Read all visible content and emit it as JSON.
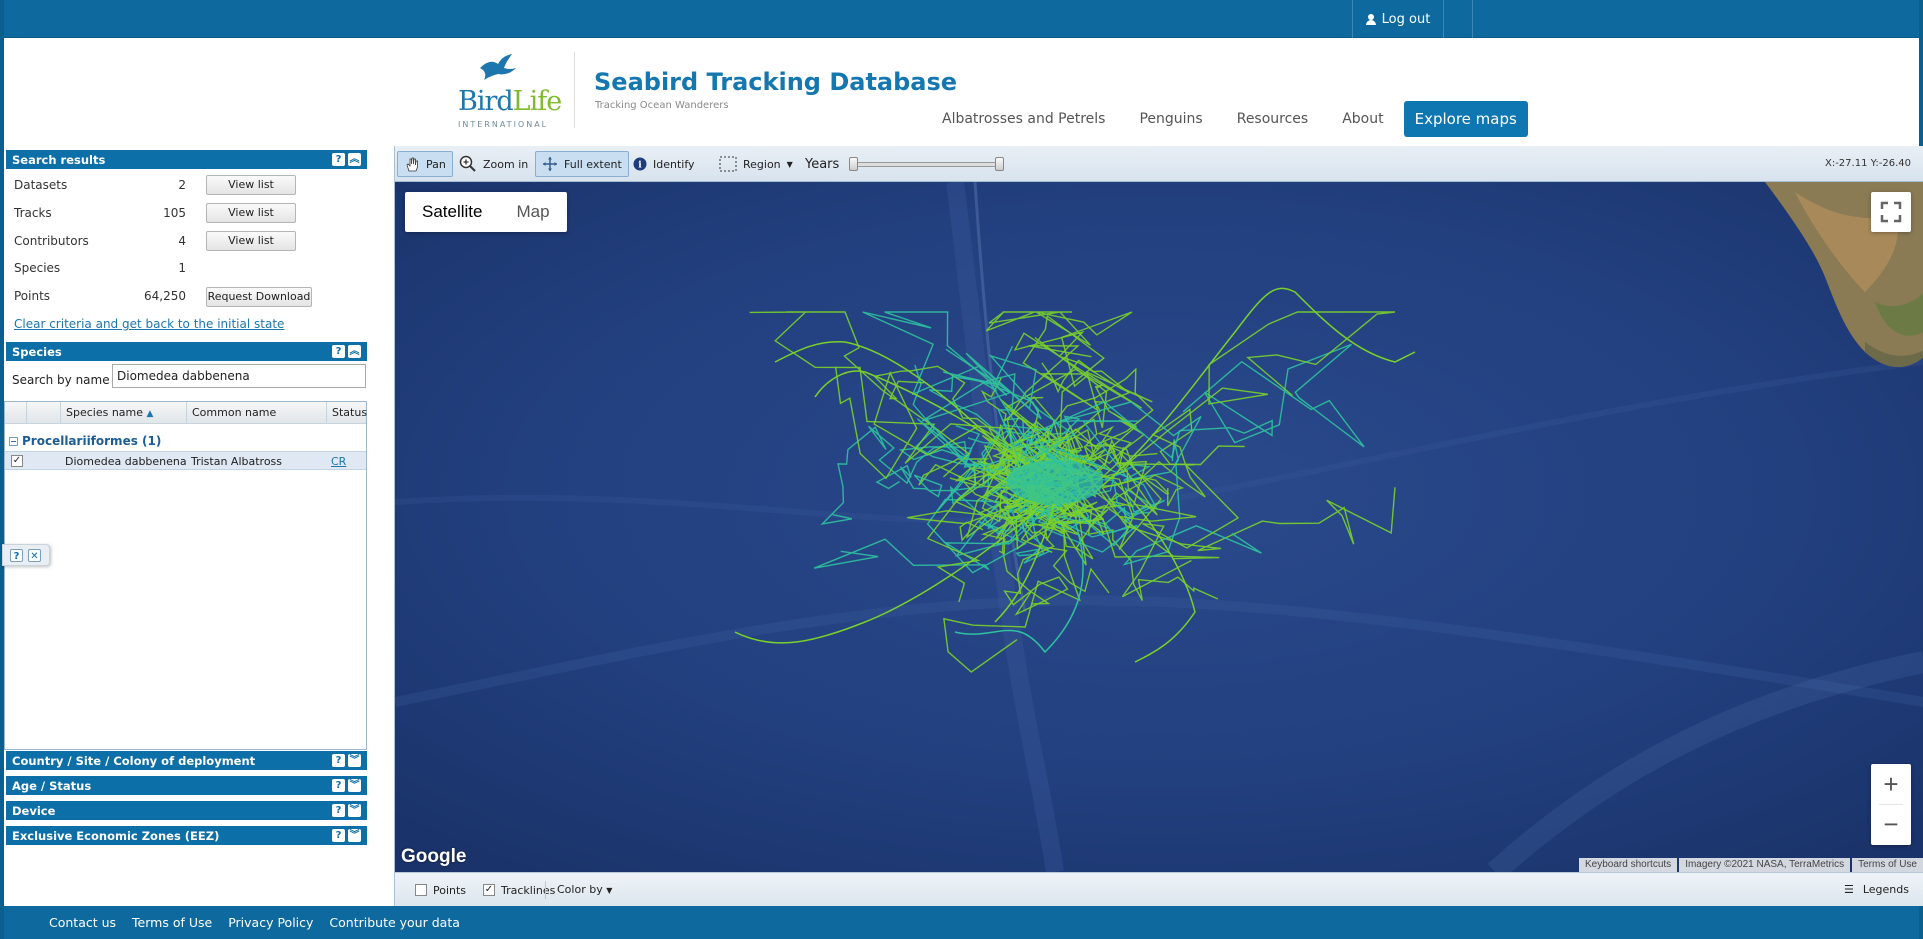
{
  "topbar": {
    "logout_label": "Log out"
  },
  "header": {
    "brand_bird": "Bird",
    "brand_life": "Life",
    "brand_intl": "INTERNATIONAL",
    "title": "Seabird Tracking Database",
    "subtitle": "Tracking Ocean Wanderers",
    "nav": [
      "Albatrosses and Petrels",
      "Penguins",
      "Resources",
      "About"
    ],
    "explore_label": "Explore maps"
  },
  "search_results": {
    "title": "Search results",
    "rows": [
      {
        "label": "Datasets",
        "value": "2",
        "button": "View list"
      },
      {
        "label": "Tracks",
        "value": "105",
        "button": "View list"
      },
      {
        "label": "Contributors",
        "value": "4",
        "button": "View list"
      },
      {
        "label": "Species",
        "value": "1"
      },
      {
        "label": "Points",
        "value": "64,250",
        "button": "Request Download"
      }
    ],
    "clear_link": "Clear criteria and get back to the initial state"
  },
  "species": {
    "title": "Species",
    "search_label": "Search by name",
    "search_value": "Diomedea dabbenena",
    "columns": [
      "Species name",
      "Common name",
      "Status"
    ],
    "group": "Procellariiformes (1)",
    "row": {
      "species": "Diomedea dabbenena",
      "common": "Tristan Albatross",
      "status": "CR",
      "checked": true
    }
  },
  "collapsed_panels": [
    "Country / Site / Colony of deployment",
    "Age / Status",
    "Device",
    "Exclusive Economic Zones (EEZ)"
  ],
  "toolbar": {
    "pan": "Pan",
    "zoom_in": "Zoom in",
    "full_extent": "Full extent",
    "identify": "Identify",
    "region": "Region",
    "years": "Years",
    "coords": "X:-27.11 Y:-26.40"
  },
  "map": {
    "type_satellite": "Satellite",
    "type_map": "Map",
    "active_type": "Satellite",
    "google": "Google",
    "attrib_shortcuts": "Keyboard shortcuts",
    "attrib_imagery": "Imagery ©2021 NASA, TerraMetrics",
    "attrib_terms": "Terms of Use",
    "ocean_color": "#1f3d7c",
    "track_colors": [
      "#7ad12a",
      "#2fc2a0"
    ]
  },
  "bottombar": {
    "points_label": "Points",
    "points_checked": false,
    "tracklines_label": "Tracklines",
    "tracklines_checked": true,
    "color_by": "Color by",
    "legends": "Legends"
  },
  "footer": [
    "Contact us",
    "Terms of Use",
    "Privacy Policy",
    "Contribute your data"
  ]
}
